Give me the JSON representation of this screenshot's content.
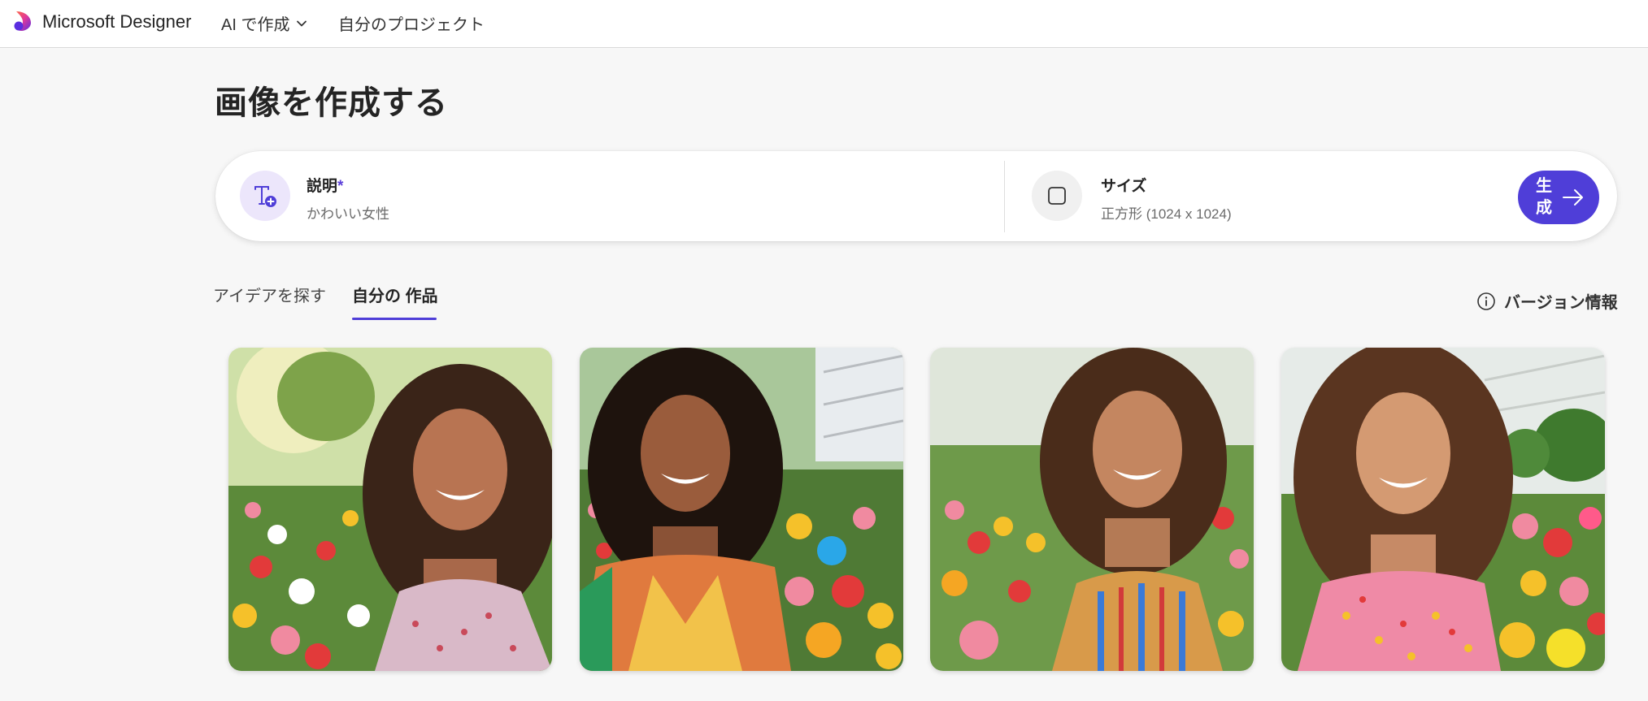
{
  "header": {
    "brand": "Microsoft Designer",
    "create_with_ai": "AI で作成",
    "my_projects": "自分のプロジェクト"
  },
  "page_title": "画像を作成する",
  "prompt": {
    "description_label": "説明",
    "required_mark": "*",
    "description_value": "かわいい女性",
    "size_label": "サイズ",
    "size_value": "正方形 (1024 x 1024)",
    "generate_label": "生成"
  },
  "tabs": [
    {
      "label": "アイデアを探す",
      "active": false
    },
    {
      "label": "自分の 作品",
      "active": true
    }
  ],
  "version_info": "バージョン情報",
  "gallery": [
    {
      "name": "generated-image-1",
      "hair": "#3a2418",
      "dress": "#d9b9c8",
      "bg": "#d7e3b8"
    },
    {
      "name": "generated-image-2",
      "hair": "#1e130d",
      "dress": "#e07a3e",
      "bg": "#c9d8c0"
    },
    {
      "name": "generated-image-3",
      "hair": "#4a2c1a",
      "dress": "#d89a4a",
      "bg": "#dfe6da"
    },
    {
      "name": "generated-image-4",
      "hair": "#5a3520",
      "dress": "#ef8aa6",
      "bg": "#e6ebe8"
    }
  ],
  "colors": {
    "accent": "#4f3ed8",
    "background": "#f7f7f7"
  }
}
